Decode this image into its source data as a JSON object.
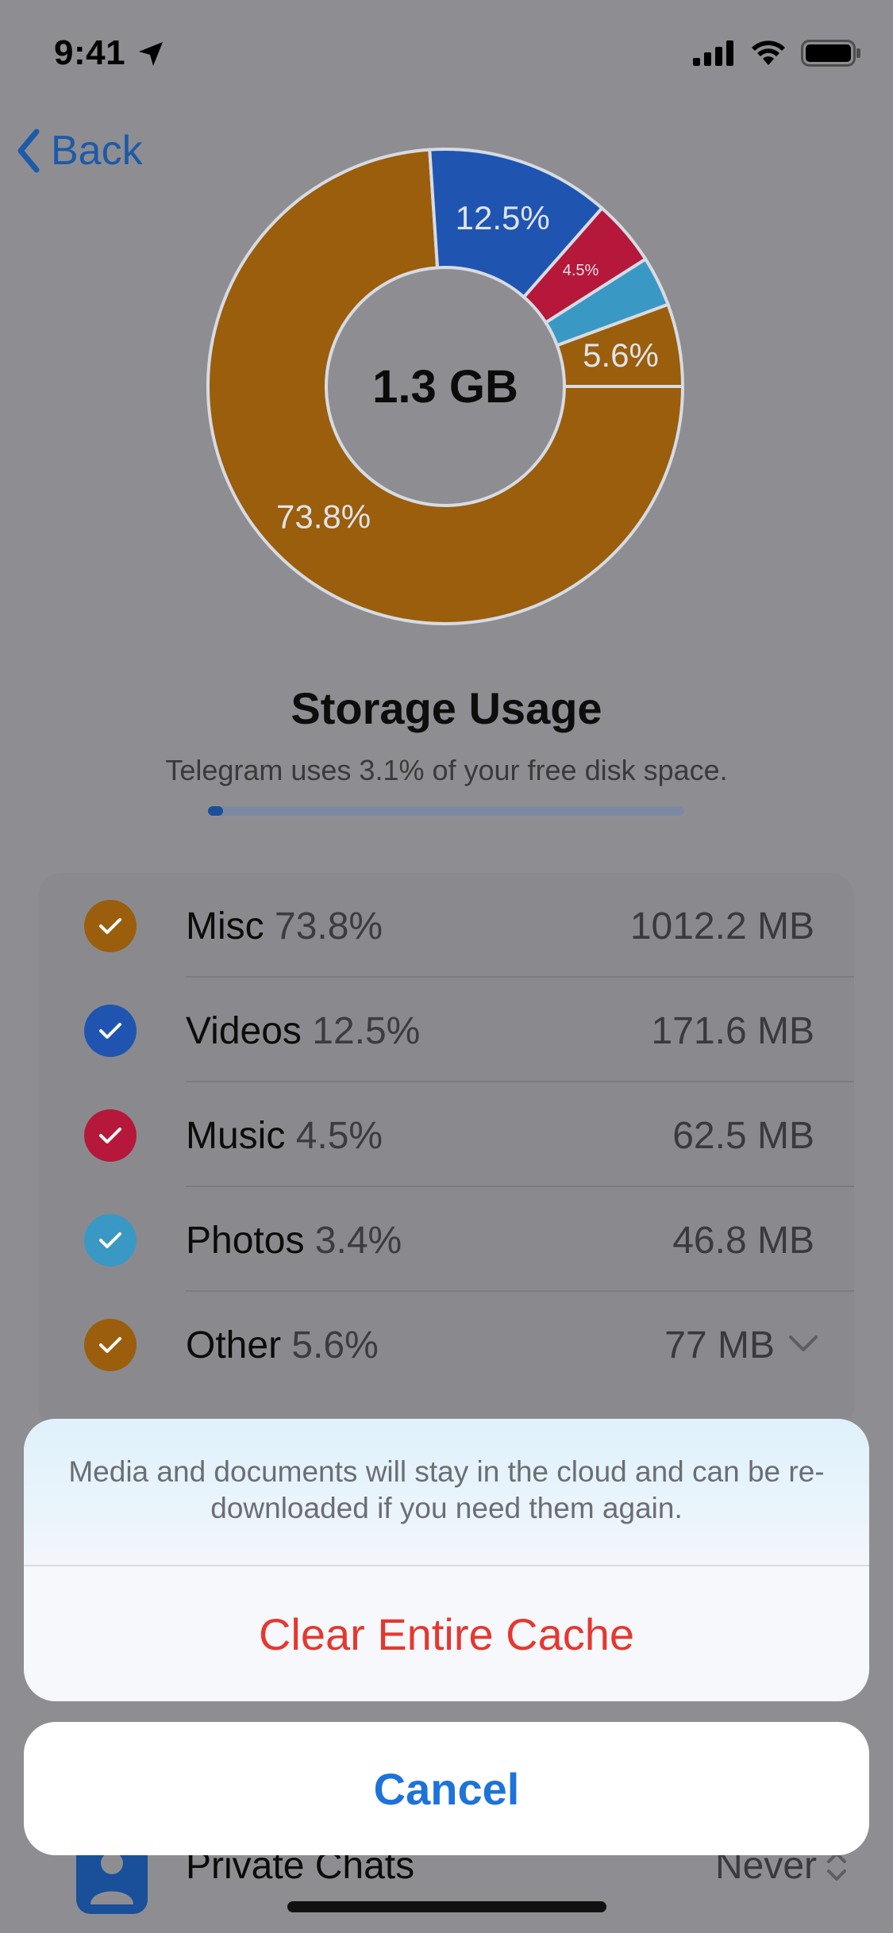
{
  "status_bar": {
    "time": "9:41"
  },
  "nav": {
    "back_label": "Back"
  },
  "chart_data": {
    "type": "pie",
    "categories": [
      "Misc",
      "Videos",
      "Music",
      "Photos",
      "Other"
    ],
    "values": [
      73.8,
      12.5,
      4.5,
      3.4,
      5.6
    ],
    "labels": [
      "73.8%",
      "12.5%",
      "4.5%",
      "",
      "5.6%"
    ],
    "colors": [
      "#9a5e0c",
      "#1f55b0",
      "#b5183a",
      "#3a98c4",
      "#9a5e0c"
    ],
    "center_label": "1.3 GB"
  },
  "storage": {
    "title": "Storage Usage",
    "subtitle": "Telegram uses 3.1% of your free disk space.",
    "usage_fraction": 0.031
  },
  "categories": [
    {
      "name": "Misc",
      "percent": "73.8%",
      "size": "1012.2 MB",
      "color": "#9a5e0c"
    },
    {
      "name": "Videos",
      "percent": "12.5%",
      "size": "171.6 MB",
      "color": "#1f55b0"
    },
    {
      "name": "Music",
      "percent": "4.5%",
      "size": "62.5 MB",
      "color": "#b5183a"
    },
    {
      "name": "Photos",
      "percent": "3.4%",
      "size": "46.8 MB",
      "color": "#3a98c4"
    },
    {
      "name": "Other",
      "percent": "5.6%",
      "size": "77 MB",
      "color": "#9a5e0c"
    }
  ],
  "private_chats": {
    "label": "Private Chats",
    "value": "Never"
  },
  "sheet": {
    "message": "Media and documents will stay in the cloud and can be re-downloaded if you need them again.",
    "clear_label": "Clear Entire Cache",
    "cancel_label": "Cancel"
  }
}
